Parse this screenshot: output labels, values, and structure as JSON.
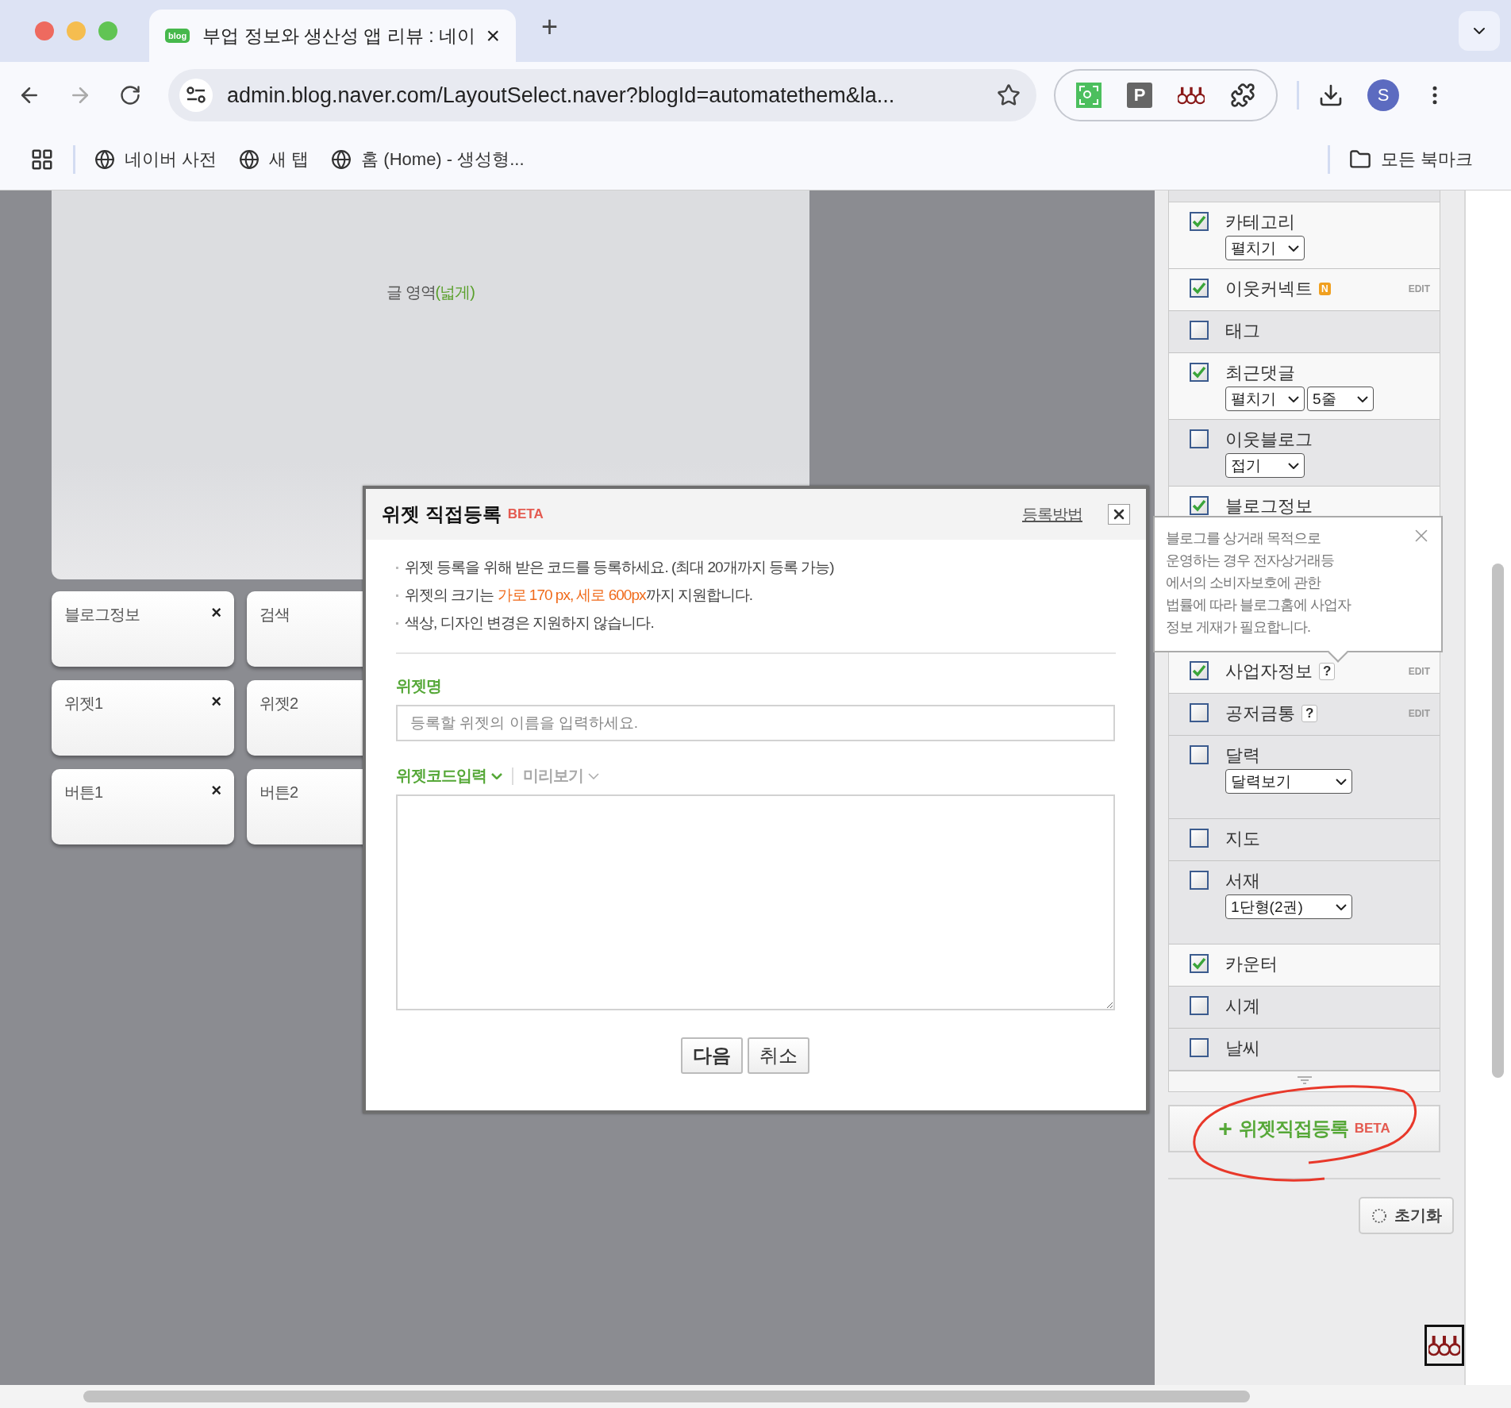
{
  "browser": {
    "tab": {
      "favicon": "blog",
      "title": "부업 정보와 생산성 앱 리뷰 : 네이",
      "close": "×"
    },
    "new_tab": "+",
    "url": "admin.blog.naver.com/LayoutSelect.naver?blogId=automatethem&la...",
    "extension_letter": "P",
    "avatar": "S",
    "bookmarks": [
      "네이버 사전",
      "새 탭",
      "홈 (Home) - 생성형..."
    ],
    "all_bookmarks": "모든 북마크"
  },
  "canvas": {
    "main_area": {
      "label": "글 영역",
      "note": "(넓게)"
    },
    "widgets": [
      {
        "name": "블로그정보",
        "close": "×"
      },
      {
        "name": "검색"
      },
      {
        "name": "위젯1",
        "close": "×"
      },
      {
        "name": "위젯2"
      },
      {
        "name": "버튼1",
        "close": "×"
      },
      {
        "name": "버튼2"
      }
    ]
  },
  "panel": {
    "items": [
      {
        "label": "카테고리",
        "checked": true,
        "selects": [
          "펼치기"
        ]
      },
      {
        "label": "이웃커넥트",
        "checked": true,
        "badge": "N",
        "edit": "EDIT"
      },
      {
        "label": "태그",
        "checked": false
      },
      {
        "label": "최근댓글",
        "checked": true,
        "selects": [
          "펼치기",
          "5줄"
        ]
      },
      {
        "label": "이웃블로그",
        "checked": false,
        "selects": [
          "접기"
        ]
      },
      {
        "label": "블로그정보",
        "checked": true
      },
      {
        "label": "사업자정보",
        "checked": true,
        "help": "?",
        "edit": "EDIT"
      },
      {
        "label": "공저금통",
        "checked": false,
        "help": "?",
        "edit": "EDIT"
      },
      {
        "label": "달력",
        "checked": false,
        "selects": [
          "달력보기"
        ]
      },
      {
        "label": "지도",
        "checked": false
      },
      {
        "label": "서재",
        "checked": false,
        "selects": [
          "1단형(2권)"
        ]
      },
      {
        "label": "카운터",
        "checked": true
      },
      {
        "label": "시계",
        "checked": false
      },
      {
        "label": "날씨",
        "checked": false
      }
    ],
    "tooltip": "블로그를 상거래 목적으로\n운영하는 경우 전자상거래등\n에서의 소비자보호에 관한\n법률에 따라 블로그홈에 사업자\n정보 게재가 필요합니다.",
    "add_button": {
      "plus": "+",
      "label": "위젯직접등록",
      "badge": "BETA"
    },
    "reset_button": "초기화"
  },
  "dialog": {
    "title": "위젯 직접등록",
    "badge": "BETA",
    "help_link": "등록방법",
    "notes": [
      {
        "text": "위젯 등록을 위해 받은 코드를 등록하세요. (최대 20개까지 등록 가능)"
      },
      {
        "text": "위젯의 크기는 ",
        "highlight": "가로 170 px, 세로 600px",
        "after": "까지 지원합니다."
      },
      {
        "text": "색상, 디자인 변경은 지원하지 않습니다."
      }
    ],
    "name_label": "위젯명",
    "name_placeholder": "등록할 위젯의 이름을 입력하세요.",
    "tabs": [
      {
        "label": "위젯코드입력",
        "selected": true
      },
      {
        "label": "미리보기",
        "selected": false
      }
    ],
    "buttons": [
      {
        "label": "다음",
        "primary": true
      },
      {
        "label": "취소",
        "primary": false
      }
    ]
  }
}
